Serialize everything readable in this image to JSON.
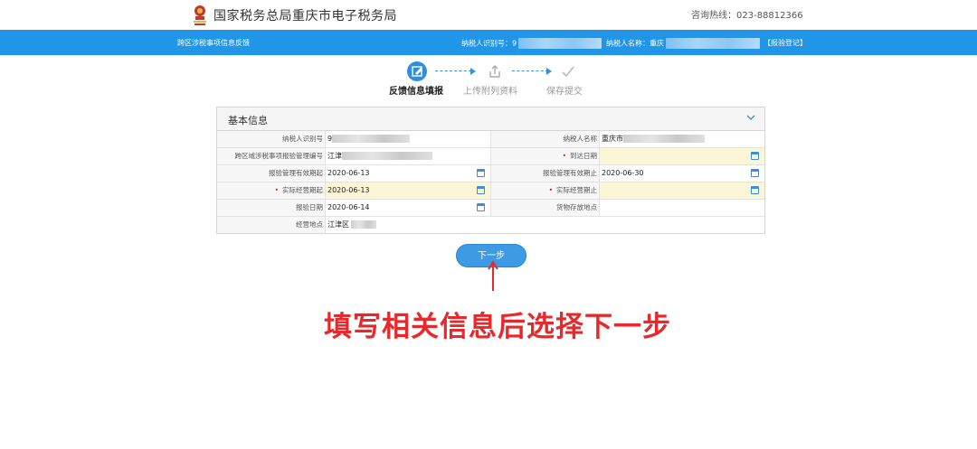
{
  "header": {
    "site_title": "国家税务总局重庆市电子税务局",
    "hotline": "咨询热线：023-88812366"
  },
  "bar": {
    "page_title": "跨区涉税事项信息反馈",
    "taxid_label": "纳税人识别号：9",
    "name_label": "纳税人名称：重庆",
    "link": "【报验登记】"
  },
  "steps": [
    {
      "label": "反馈信息填报",
      "icon": "edit-icon",
      "state": "active"
    },
    {
      "label": "上传附列资料",
      "icon": "upload-icon",
      "state": "pending"
    },
    {
      "label": "保存提交",
      "icon": "check-icon",
      "state": "pending"
    }
  ],
  "panel": {
    "title": "基本信息",
    "rows": [
      {
        "l_label": "纳税人识别号",
        "l_value": "9",
        "r_label": "纳税人名称",
        "r_value": "重庆市"
      },
      {
        "l_label": "跨区域涉税事项报验管理编号",
        "l_value": "江津",
        "r_label": "到达日期",
        "r_value": ""
      },
      {
        "l_label": "报验管理有效期起",
        "l_value": "2020-06-13",
        "r_label": "报验管理有效期止",
        "r_value": "2020-06-30"
      },
      {
        "l_label": "实际经营期起",
        "l_value": "2020-06-13",
        "r_label": "实际经营期止",
        "r_value": ""
      },
      {
        "l_label": "报验日期",
        "l_value": "2020-06-14",
        "r_label": "货物存放地点",
        "r_value": ""
      },
      {
        "l_label": "经营地点",
        "l_value": "江津区"
      }
    ]
  },
  "next_button": "下一步",
  "instruction": "填写相关信息后选择下一步",
  "colors": {
    "brand_blue": "#2196e8",
    "required": "#e02020",
    "annotation": "#e8282b",
    "highlight": "#fdf6d6"
  }
}
